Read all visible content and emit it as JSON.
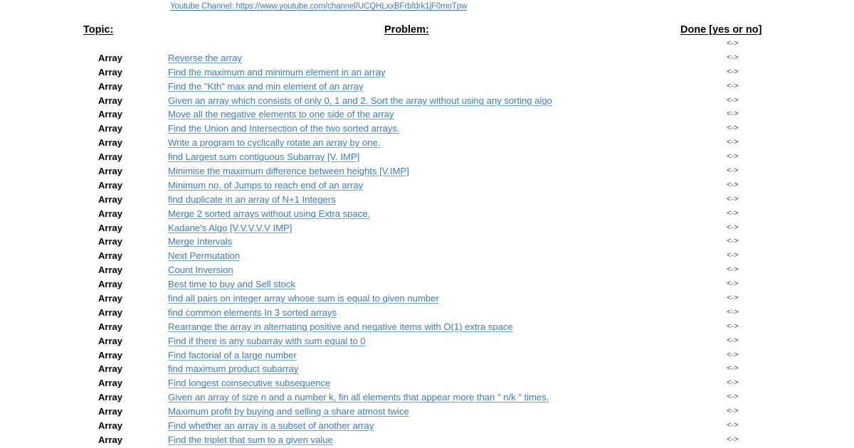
{
  "channel": {
    "label": "Youtube Channel: https://www.youtube.com/channel/UCQHLxxBFrbfdrk1jF0moTpw"
  },
  "header": {
    "topic": "Topic:",
    "problem": "Problem:",
    "done": "Done [yes or no]"
  },
  "done_marker": "<->",
  "rows": [
    {
      "topic": "Array",
      "problem": "Reverse the array",
      "done": "<->"
    },
    {
      "topic": "Array",
      "problem": "Find the maximum and minimum element in an array",
      "done": "<->"
    },
    {
      "topic": "Array",
      "problem": "Find the \"Kth\" max and min element of an array ",
      "done": "<->"
    },
    {
      "topic": "Array",
      "problem": "Given an array which consists of only 0, 1 and 2. Sort the array without using any sorting algo",
      "done": "<->"
    },
    {
      "topic": "Array",
      "problem": "Move all the negative elements to one side of the array ",
      "done": "<->"
    },
    {
      "topic": "Array",
      "problem": "Find the Union and Intersection of the two sorted arrays.",
      "done": "<->"
    },
    {
      "topic": "Array",
      "problem": "Write a program to cyclically rotate an array by one.",
      "done": "<->"
    },
    {
      "topic": "Array",
      "problem": "find Largest sum contiguous Subarray [V. IMP]",
      "done": "<->"
    },
    {
      "topic": "Array",
      "problem": "Minimise the maximum difference between heights [V.IMP]",
      "done": "<->"
    },
    {
      "topic": "Array",
      "problem": "Minimum no. of Jumps to reach end of an array",
      "done": "<->"
    },
    {
      "topic": "Array",
      "problem": "find duplicate in an array of N+1 Integers",
      "done": "<->"
    },
    {
      "topic": "Array",
      "problem": "Merge 2 sorted arrays without using Extra space.",
      "done": "<->"
    },
    {
      "topic": "Array",
      "problem": "Kadane's Algo [V.V.V.V.V IMP]",
      "done": "<->"
    },
    {
      "topic": "Array",
      "problem": "Merge Intervals",
      "done": "<->"
    },
    {
      "topic": "Array",
      "problem": "Next Permutation",
      "done": "<->"
    },
    {
      "topic": "Array",
      "problem": "Count Inversion",
      "done": "<->"
    },
    {
      "topic": "Array",
      "problem": "Best time to buy and Sell stock",
      "done": "<->"
    },
    {
      "topic": "Array",
      "problem": "find all pairs on integer array whose sum is equal to given number",
      "done": "<->"
    },
    {
      "topic": "Array",
      "problem": "find common elements In 3 sorted arrays",
      "done": "<->"
    },
    {
      "topic": "Array",
      "problem": "Rearrange the array in alternating positive and negative items with O(1) extra space",
      "done": "<->"
    },
    {
      "topic": "Array",
      "problem": "Find if there is any subarray with sum equal to 0",
      "done": "<->"
    },
    {
      "topic": "Array",
      "problem": "Find factorial of a large number",
      "done": "<->"
    },
    {
      "topic": "Array",
      "problem": "find maximum product subarray ",
      "done": "<->"
    },
    {
      "topic": "Array",
      "problem": "Find longest coinsecutive subsequence",
      "done": "<->"
    },
    {
      "topic": "Array",
      "problem": "Given an array of size n and a number k, fin all elements that appear more than \" n/k \" times.",
      "done": "<->"
    },
    {
      "topic": "Array",
      "problem": "Maximum profit by buying and selling a share atmost twice",
      "done": "<->"
    },
    {
      "topic": "Array",
      "problem": "Find whether an array is a subset of another array",
      "done": "<->"
    },
    {
      "topic": "Array",
      "problem": "Find the triplet that sum to a given value",
      "done": "<->"
    }
  ]
}
